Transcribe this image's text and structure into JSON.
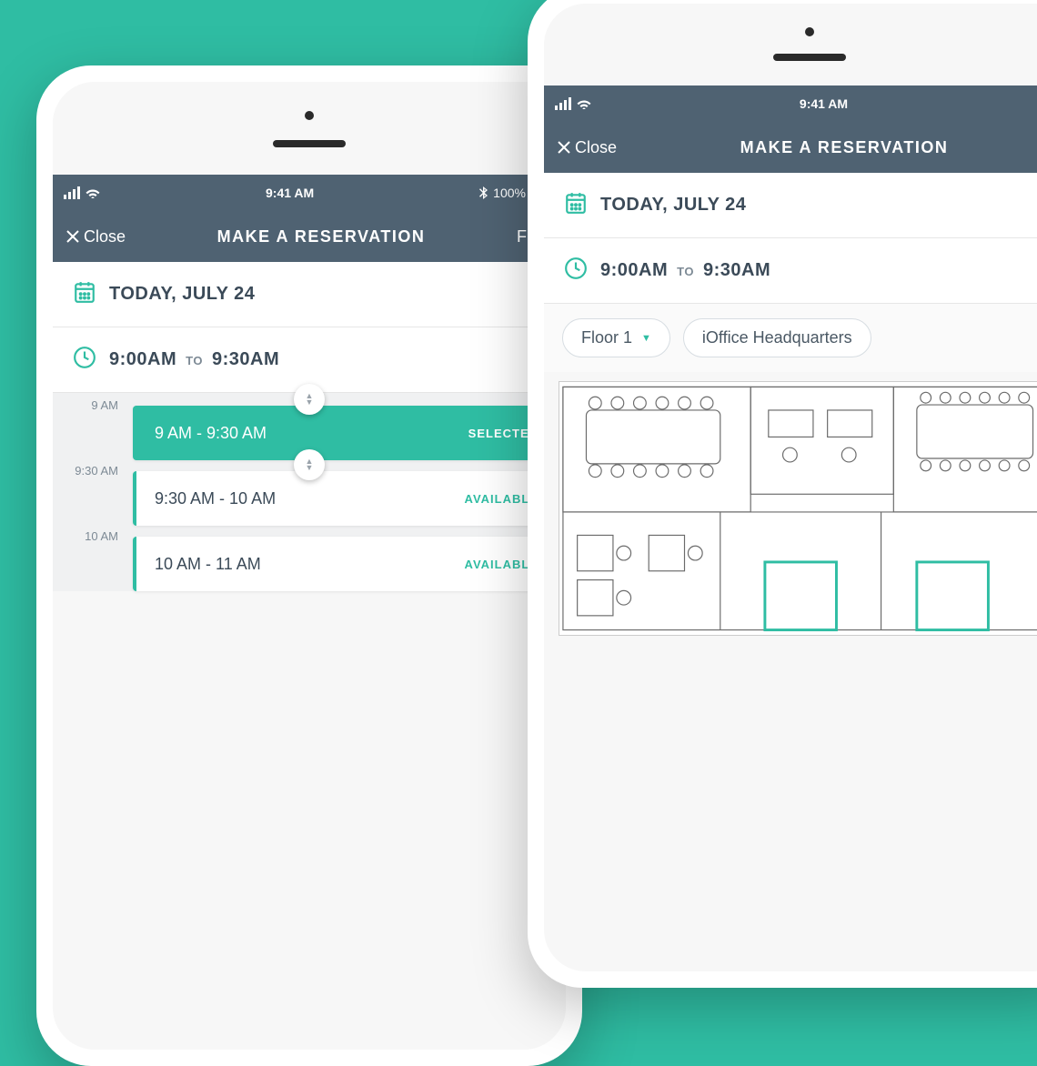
{
  "status": {
    "time": "9:41 AM",
    "battery": "100%"
  },
  "nav": {
    "close": "Close",
    "title": "MAKE A RESERVATION",
    "filter": "Filter"
  },
  "date_row": "TODAY, JULY 24",
  "time_row": {
    "start": "9:00AM",
    "sep": "TO",
    "end": "9:30AM"
  },
  "timeline": {
    "labels": [
      "9 AM",
      "9:30 AM",
      "10 AM"
    ],
    "slots": [
      {
        "time": "9 AM - 9:30 AM",
        "status": "SELECTED",
        "selected": true
      },
      {
        "time": "9:30 AM - 10 AM",
        "status": "AVAILABLE",
        "selected": false
      },
      {
        "time": "10 AM - 11 AM",
        "status": "AVAILABLE",
        "selected": false
      }
    ]
  },
  "pills": {
    "floor": "Floor 1",
    "building": "iOffice Headquarters"
  }
}
